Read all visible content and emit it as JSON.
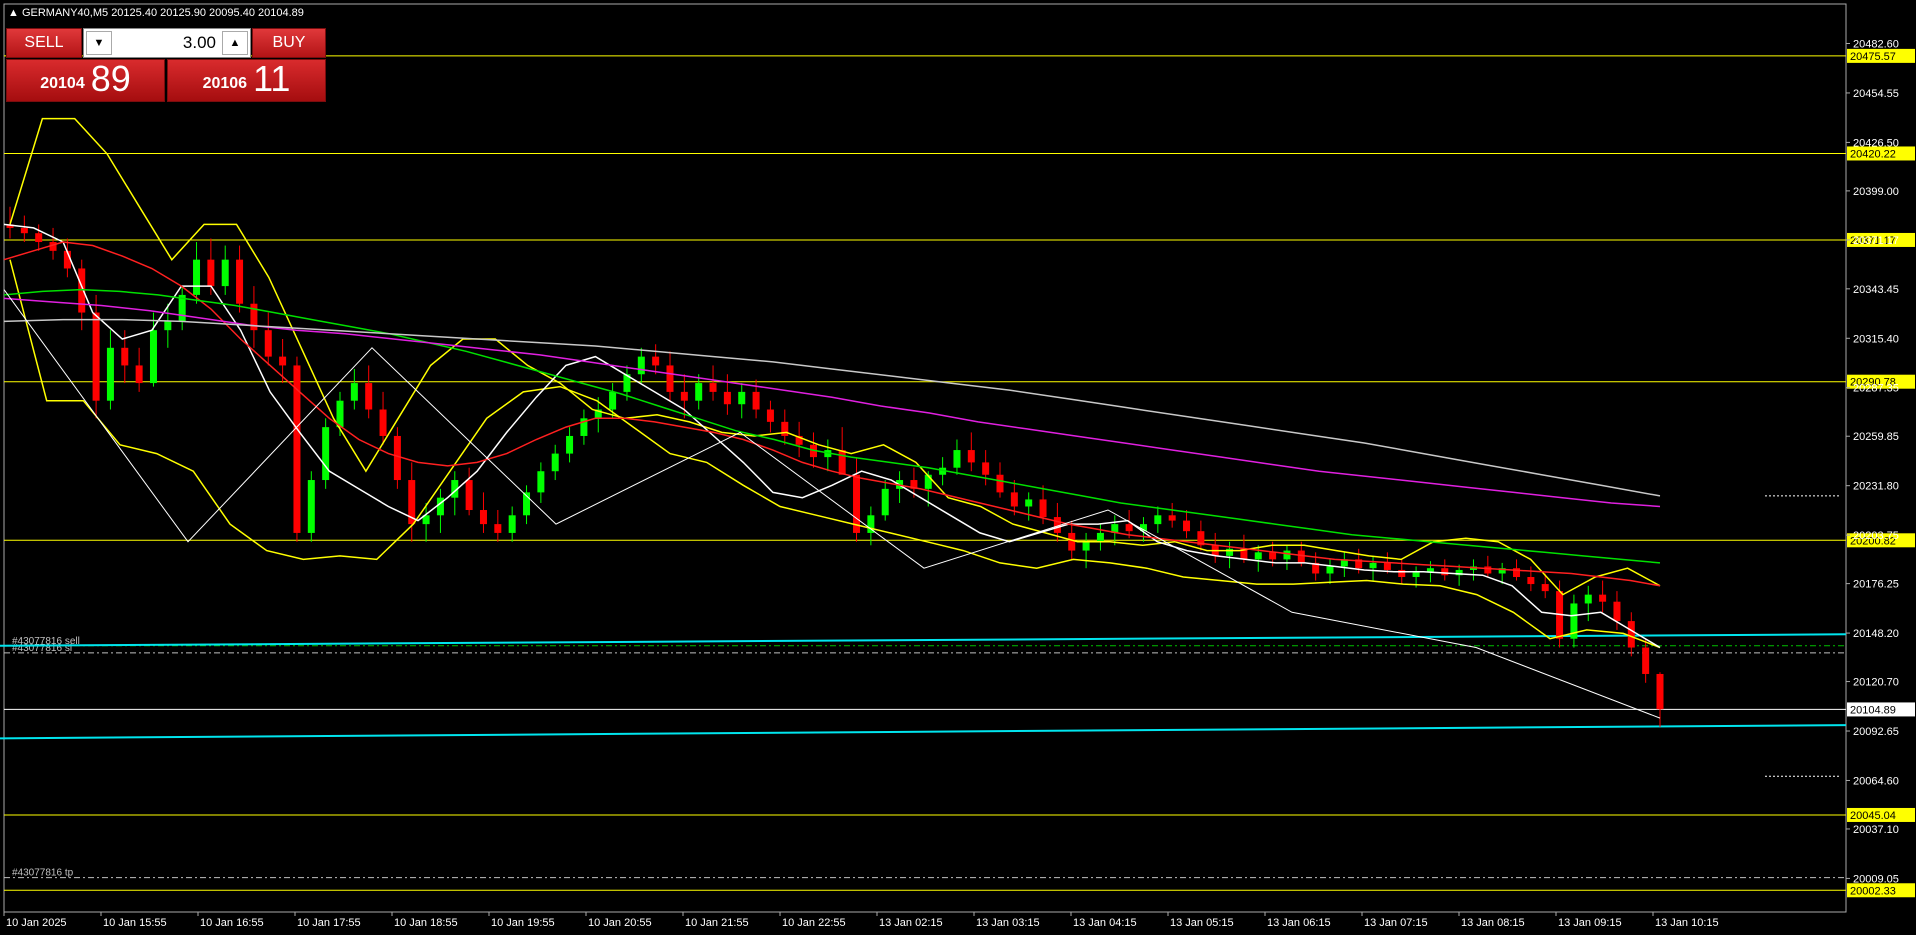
{
  "chart_data": {
    "type": "candlestick",
    "title": "GERMANY40,M5  20125.40 20125.90 20095.40 20104.89",
    "symbol": "GERMANY40",
    "timeframe": "M5",
    "ylim": [
      19990,
      20505
    ],
    "y_ticks": [
      "20482.60",
      "20454.55",
      "20426.50",
      "20399.00",
      "20371.17",
      "20343.45",
      "20315.40",
      "20287.35",
      "20259.85",
      "20231.80",
      "20203.75",
      "20176.25",
      "20148.20",
      "20120.70",
      "20092.65",
      "20064.60",
      "20037.10",
      "20009.05"
    ],
    "x_labels": [
      "10 Jan 2025",
      "10 Jan 15:55",
      "10 Jan 16:55",
      "10 Jan 17:55",
      "10 Jan 18:55",
      "10 Jan 19:55",
      "10 Jan 20:55",
      "10 Jan 21:55",
      "10 Jan 22:55",
      "13 Jan 02:15",
      "13 Jan 03:15",
      "13 Jan 04:15",
      "13 Jan 05:15",
      "13 Jan 06:15",
      "13 Jan 07:15",
      "13 Jan 08:15",
      "13 Jan 09:15",
      "13 Jan 10:15"
    ],
    "grid": false,
    "current_price": "20104.89",
    "horizontal_levels": [
      {
        "value": 20475.57,
        "label": "20475.57",
        "color": "#ffff00"
      },
      {
        "value": 20420.22,
        "label": "20420.22",
        "color": "#ffff00"
      },
      {
        "value": 20371.17,
        "label": "20371.17",
        "color": "#ffff00"
      },
      {
        "value": 20290.78,
        "label": "20290.78",
        "color": "#ffff00"
      },
      {
        "value": 20200.82,
        "label": "20200.82",
        "color": "#ffff00"
      },
      {
        "value": 20045.04,
        "label": "20045.04",
        "color": "#ffff00"
      },
      {
        "value": 20002.33,
        "label": "20002.33",
        "color": "#ffff00"
      }
    ],
    "order_lines": [
      {
        "label": "#43077816 sell",
        "value": 20141.0,
        "color": "#00c000"
      },
      {
        "label": "#43077816 sl",
        "value": 20137.0,
        "color": "#c0c0c0"
      },
      {
        "label": "#43077816 tp",
        "value": 20009.5,
        "color": "#c0c0c0"
      }
    ],
    "trend_channel": [
      {
        "from": [
          0,
          20141.0
        ],
        "to": [
          1916,
          20147.5
        ]
      },
      {
        "from": [
          0,
          20088.5
        ],
        "to": [
          1916,
          20096.0
        ]
      }
    ],
    "candles": [
      {
        "o": 20380,
        "h": 20390,
        "l": 20372,
        "c": 20378
      },
      {
        "o": 20378,
        "h": 20385,
        "l": 20370,
        "c": 20375
      },
      {
        "o": 20375,
        "h": 20380,
        "l": 20365,
        "c": 20370
      },
      {
        "o": 20370,
        "h": 20378,
        "l": 20360,
        "c": 20365
      },
      {
        "o": 20365,
        "h": 20372,
        "l": 20350,
        "c": 20355
      },
      {
        "o": 20355,
        "h": 20360,
        "l": 20320,
        "c": 20330
      },
      {
        "o": 20330,
        "h": 20340,
        "l": 20270,
        "c": 20280
      },
      {
        "o": 20280,
        "h": 20320,
        "l": 20275,
        "c": 20310
      },
      {
        "o": 20310,
        "h": 20320,
        "l": 20290,
        "c": 20300
      },
      {
        "o": 20300,
        "h": 20310,
        "l": 20285,
        "c": 20290
      },
      {
        "o": 20290,
        "h": 20330,
        "l": 20288,
        "c": 20320
      },
      {
        "o": 20320,
        "h": 20335,
        "l": 20310,
        "c": 20325
      },
      {
        "o": 20325,
        "h": 20345,
        "l": 20320,
        "c": 20340
      },
      {
        "o": 20340,
        "h": 20370,
        "l": 20335,
        "c": 20360
      },
      {
        "o": 20360,
        "h": 20372,
        "l": 20340,
        "c": 20345
      },
      {
        "o": 20345,
        "h": 20368,
        "l": 20340,
        "c": 20360
      },
      {
        "o": 20360,
        "h": 20368,
        "l": 20330,
        "c": 20335
      },
      {
        "o": 20335,
        "h": 20345,
        "l": 20310,
        "c": 20320
      },
      {
        "o": 20320,
        "h": 20330,
        "l": 20300,
        "c": 20305
      },
      {
        "o": 20305,
        "h": 20315,
        "l": 20290,
        "c": 20300
      },
      {
        "o": 20300,
        "h": 20305,
        "l": 20200,
        "c": 20205
      },
      {
        "o": 20205,
        "h": 20240,
        "l": 20200,
        "c": 20235
      },
      {
        "o": 20235,
        "h": 20270,
        "l": 20230,
        "c": 20265
      },
      {
        "o": 20265,
        "h": 20285,
        "l": 20260,
        "c": 20280
      },
      {
        "o": 20280,
        "h": 20298,
        "l": 20275,
        "c": 20290
      },
      {
        "o": 20290,
        "h": 20300,
        "l": 20270,
        "c": 20275
      },
      {
        "o": 20275,
        "h": 20285,
        "l": 20255,
        "c": 20260
      },
      {
        "o": 20260,
        "h": 20265,
        "l": 20230,
        "c": 20235
      },
      {
        "o": 20235,
        "h": 20245,
        "l": 20200,
        "c": 20210
      },
      {
        "o": 20210,
        "h": 20222,
        "l": 20200,
        "c": 20215
      },
      {
        "o": 20215,
        "h": 20230,
        "l": 20205,
        "c": 20225
      },
      {
        "o": 20225,
        "h": 20240,
        "l": 20215,
        "c": 20235
      },
      {
        "o": 20235,
        "h": 20242,
        "l": 20215,
        "c": 20218
      },
      {
        "o": 20218,
        "h": 20228,
        "l": 20205,
        "c": 20210
      },
      {
        "o": 20210,
        "h": 20218,
        "l": 20200,
        "c": 20205
      },
      {
        "o": 20205,
        "h": 20220,
        "l": 20200,
        "c": 20215
      },
      {
        "o": 20215,
        "h": 20232,
        "l": 20210,
        "c": 20228
      },
      {
        "o": 20228,
        "h": 20245,
        "l": 20222,
        "c": 20240
      },
      {
        "o": 20240,
        "h": 20255,
        "l": 20235,
        "c": 20250
      },
      {
        "o": 20250,
        "h": 20265,
        "l": 20245,
        "c": 20260
      },
      {
        "o": 20260,
        "h": 20275,
        "l": 20255,
        "c": 20270
      },
      {
        "o": 20270,
        "h": 20282,
        "l": 20262,
        "c": 20275
      },
      {
        "o": 20275,
        "h": 20290,
        "l": 20270,
        "c": 20285
      },
      {
        "o": 20285,
        "h": 20300,
        "l": 20280,
        "c": 20295
      },
      {
        "o": 20295,
        "h": 20310,
        "l": 20290,
        "c": 20305
      },
      {
        "o": 20305,
        "h": 20312,
        "l": 20295,
        "c": 20300
      },
      {
        "o": 20300,
        "h": 20308,
        "l": 20280,
        "c": 20285
      },
      {
        "o": 20285,
        "h": 20295,
        "l": 20270,
        "c": 20280
      },
      {
        "o": 20280,
        "h": 20295,
        "l": 20275,
        "c": 20290
      },
      {
        "o": 20290,
        "h": 20300,
        "l": 20280,
        "c": 20285
      },
      {
        "o": 20285,
        "h": 20295,
        "l": 20272,
        "c": 20278
      },
      {
        "o": 20278,
        "h": 20290,
        "l": 20270,
        "c": 20285
      },
      {
        "o": 20285,
        "h": 20292,
        "l": 20270,
        "c": 20275
      },
      {
        "o": 20275,
        "h": 20280,
        "l": 20262,
        "c": 20268
      },
      {
        "o": 20268,
        "h": 20275,
        "l": 20255,
        "c": 20260
      },
      {
        "o": 20260,
        "h": 20268,
        "l": 20248,
        "c": 20255
      },
      {
        "o": 20255,
        "h": 20262,
        "l": 20242,
        "c": 20248
      },
      {
        "o": 20248,
        "h": 20258,
        "l": 20240,
        "c": 20252
      },
      {
        "o": 20252,
        "h": 20265,
        "l": 20245,
        "c": 20238
      },
      {
        "o": 20238,
        "h": 20248,
        "l": 20200,
        "c": 20205
      },
      {
        "o": 20205,
        "h": 20220,
        "l": 20198,
        "c": 20215
      },
      {
        "o": 20215,
        "h": 20235,
        "l": 20212,
        "c": 20230
      },
      {
        "o": 20230,
        "h": 20240,
        "l": 20222,
        "c": 20235
      },
      {
        "o": 20235,
        "h": 20242,
        "l": 20225,
        "c": 20230
      },
      {
        "o": 20230,
        "h": 20240,
        "l": 20220,
        "c": 20238
      },
      {
        "o": 20238,
        "h": 20248,
        "l": 20232,
        "c": 20242
      },
      {
        "o": 20242,
        "h": 20258,
        "l": 20238,
        "c": 20252
      },
      {
        "o": 20252,
        "h": 20262,
        "l": 20240,
        "c": 20245
      },
      {
        "o": 20245,
        "h": 20252,
        "l": 20232,
        "c": 20238
      },
      {
        "o": 20238,
        "h": 20245,
        "l": 20225,
        "c": 20228
      },
      {
        "o": 20228,
        "h": 20235,
        "l": 20215,
        "c": 20220
      },
      {
        "o": 20220,
        "h": 20228,
        "l": 20212,
        "c": 20224
      },
      {
        "o": 20224,
        "h": 20232,
        "l": 20210,
        "c": 20214
      },
      {
        "o": 20214,
        "h": 20222,
        "l": 20200,
        "c": 20205
      },
      {
        "o": 20205,
        "h": 20212,
        "l": 20190,
        "c": 20195
      },
      {
        "o": 20195,
        "h": 20205,
        "l": 20185,
        "c": 20200
      },
      {
        "o": 20200,
        "h": 20210,
        "l": 20195,
        "c": 20205
      },
      {
        "o": 20205,
        "h": 20215,
        "l": 20198,
        "c": 20210
      },
      {
        "o": 20210,
        "h": 20218,
        "l": 20202,
        "c": 20206
      },
      {
        "o": 20206,
        "h": 20214,
        "l": 20200,
        "c": 20210
      },
      {
        "o": 20210,
        "h": 20220,
        "l": 20205,
        "c": 20215
      },
      {
        "o": 20215,
        "h": 20222,
        "l": 20208,
        "c": 20212
      },
      {
        "o": 20212,
        "h": 20218,
        "l": 20202,
        "c": 20206
      },
      {
        "o": 20206,
        "h": 20212,
        "l": 20195,
        "c": 20198
      },
      {
        "o": 20198,
        "h": 20205,
        "l": 20188,
        "c": 20192
      },
      {
        "o": 20192,
        "h": 20200,
        "l": 20185,
        "c": 20196
      },
      {
        "o": 20196,
        "h": 20204,
        "l": 20188,
        "c": 20190
      },
      {
        "o": 20190,
        "h": 20198,
        "l": 20183,
        "c": 20194
      },
      {
        "o": 20194,
        "h": 20200,
        "l": 20186,
        "c": 20190
      },
      {
        "o": 20190,
        "h": 20198,
        "l": 20184,
        "c": 20195
      },
      {
        "o": 20195,
        "h": 20200,
        "l": 20186,
        "c": 20188
      },
      {
        "o": 20188,
        "h": 20194,
        "l": 20178,
        "c": 20182
      },
      {
        "o": 20182,
        "h": 20190,
        "l": 20176,
        "c": 20186
      },
      {
        "o": 20186,
        "h": 20194,
        "l": 20180,
        "c": 20190
      },
      {
        "o": 20190,
        "h": 20196,
        "l": 20182,
        "c": 20185
      },
      {
        "o": 20185,
        "h": 20192,
        "l": 20178,
        "c": 20188
      },
      {
        "o": 20188,
        "h": 20194,
        "l": 20182,
        "c": 20184
      },
      {
        "o": 20184,
        "h": 20190,
        "l": 20176,
        "c": 20180
      },
      {
        "o": 20180,
        "h": 20186,
        "l": 20174,
        "c": 20183
      },
      {
        "o": 20183,
        "h": 20189,
        "l": 20177,
        "c": 20185
      },
      {
        "o": 20185,
        "h": 20190,
        "l": 20178,
        "c": 20181
      },
      {
        "o": 20181,
        "h": 20187,
        "l": 20175,
        "c": 20184
      },
      {
        "o": 20184,
        "h": 20190,
        "l": 20178,
        "c": 20186
      },
      {
        "o": 20186,
        "h": 20192,
        "l": 20180,
        "c": 20182
      },
      {
        "o": 20182,
        "h": 20188,
        "l": 20176,
        "c": 20185
      },
      {
        "o": 20185,
        "h": 20190,
        "l": 20178,
        "c": 20180
      },
      {
        "o": 20180,
        "h": 20186,
        "l": 20172,
        "c": 20176
      },
      {
        "o": 20176,
        "h": 20182,
        "l": 20168,
        "c": 20172
      },
      {
        "o": 20172,
        "h": 20178,
        "l": 20140,
        "c": 20145
      },
      {
        "o": 20145,
        "h": 20170,
        "l": 20140,
        "c": 20165
      },
      {
        "o": 20165,
        "h": 20175,
        "l": 20155,
        "c": 20170
      },
      {
        "o": 20170,
        "h": 20178,
        "l": 20160,
        "c": 20166
      },
      {
        "o": 20166,
        "h": 20172,
        "l": 20150,
        "c": 20155
      },
      {
        "o": 20155,
        "h": 20160,
        "l": 20135,
        "c": 20140
      },
      {
        "o": 20140,
        "h": 20145,
        "l": 20120,
        "c": 20125
      },
      {
        "o": 20125,
        "h": 20126,
        "l": 20095,
        "c": 20105
      }
    ],
    "moving_averages": [
      {
        "color": "#ffffff",
        "points": [
          20380,
          20378,
          20370,
          20330,
          20315,
          20320,
          20345,
          20345,
          20320,
          20285,
          20262,
          20240,
          20230,
          20220,
          20212,
          20225,
          20240,
          20262,
          20282,
          20300,
          20305,
          20295,
          20285,
          20275,
          20260,
          20245,
          20228,
          20225,
          20232,
          20240,
          20235,
          20225,
          20215,
          20205,
          20200,
          20205,
          20210,
          20210,
          20212,
          20200,
          20195,
          20192,
          20190,
          20188,
          20188,
          20186,
          20184,
          20183,
          20183,
          20182,
          20181,
          20175,
          20160,
          20158,
          20160,
          20150,
          20140
        ]
      },
      {
        "color": "#ff2020",
        "points": [
          20360,
          20365,
          20370,
          20368,
          20362,
          20355,
          20345,
          20332,
          20315,
          20300,
          20285,
          20270,
          20258,
          20250,
          20245,
          20243,
          20245,
          20250,
          20258,
          20265,
          20270,
          20270,
          20268,
          20265,
          20262,
          20258,
          20252,
          20245,
          20240,
          20236,
          20233,
          20230,
          20226,
          20222,
          20218,
          20214,
          20210,
          20207,
          20204,
          20202,
          20200,
          20198,
          20196,
          20194,
          20192,
          20190,
          20189,
          20188,
          20187,
          20186,
          20185,
          20184,
          20183,
          20182,
          20180,
          20178,
          20175
        ]
      },
      {
        "color": "#00e000",
        "points": [
          20340,
          20342,
          20343,
          20342,
          20340,
          20337,
          20334,
          20330,
          20326,
          20322,
          20318,
          20313,
          20308,
          20302,
          20296,
          20290,
          20284,
          20277,
          20270,
          20263,
          20258,
          20252,
          20248,
          20245,
          20242,
          20238,
          20234,
          20230,
          20226,
          20222,
          20219,
          20216,
          20213,
          20210,
          20207,
          20204,
          20202,
          20200,
          20198,
          20196,
          20194,
          20192,
          20190,
          20188
        ]
      },
      {
        "color": "#e020e0",
        "points": [
          20338,
          20336,
          20334,
          20331,
          20327,
          20323,
          20320,
          20318,
          20315,
          20312,
          20309,
          20306,
          20302,
          20298,
          20294,
          20290,
          20286,
          20282,
          20277,
          20273,
          20268,
          20264,
          20260,
          20256,
          20252,
          20248,
          20244,
          20240,
          20237,
          20234,
          20231,
          20228,
          20225,
          20222,
          20220
        ]
      },
      {
        "color": "#c8c8c8",
        "points": [
          20325,
          20326,
          20326,
          20325,
          20323,
          20321,
          20319,
          20317,
          20315,
          20313,
          20311,
          20308,
          20305,
          20302,
          20298,
          20294,
          20290,
          20286,
          20281,
          20276,
          20271,
          20266,
          20261,
          20256,
          20250,
          20244,
          20238,
          20232,
          20226
        ]
      }
    ],
    "bollinger": {
      "color": "#ffff00",
      "upper": [
        20380,
        20440,
        20440,
        20420,
        20390,
        20360,
        20380,
        20380,
        20350,
        20310,
        20270,
        20240,
        20270,
        20300,
        20315,
        20315,
        20300,
        20290,
        20275,
        20270,
        20272,
        20268,
        20262,
        20260,
        20262,
        20255,
        20250,
        20255,
        20245,
        20225,
        20220,
        20210,
        20205,
        20200,
        20200,
        20198,
        20200,
        20195,
        20195,
        20198,
        20198,
        20195,
        20192,
        20190,
        20200,
        20202,
        20200,
        20190,
        20170,
        20180,
        20185,
        20175
      ],
      "lower": [
        20360,
        20280,
        20280,
        20255,
        20250,
        20240,
        20210,
        20195,
        20190,
        20192,
        20190,
        20210,
        20240,
        20270,
        20285,
        20288,
        20280,
        20265,
        20250,
        20245,
        20232,
        20220,
        20215,
        20210,
        20205,
        20200,
        20195,
        20188,
        20185,
        20190,
        20188,
        20185,
        20180,
        20178,
        20176,
        20176,
        20177,
        20178,
        20176,
        20175,
        20170,
        20160,
        20145,
        20150,
        20148,
        20140
      ]
    },
    "zigzag": [
      20343,
      20200,
      20310,
      20210,
      20262,
      20185,
      20218,
      20160,
      20140,
      20100
    ]
  },
  "ui": {
    "sell_label": "SELL",
    "buy_label": "BUY",
    "volume": "3.00",
    "bid_main": "20104",
    "bid_big": "89",
    "ask_main": "20106",
    "ask_big": "11",
    "down_arrow": "▼",
    "up_arrow": "▲"
  },
  "colors": {
    "background": "#000000",
    "bull": "#00ff00",
    "bear": "#ff0000",
    "level": "#ffff00",
    "channel": "#00e5ee",
    "panel_red": "#c8191b"
  }
}
